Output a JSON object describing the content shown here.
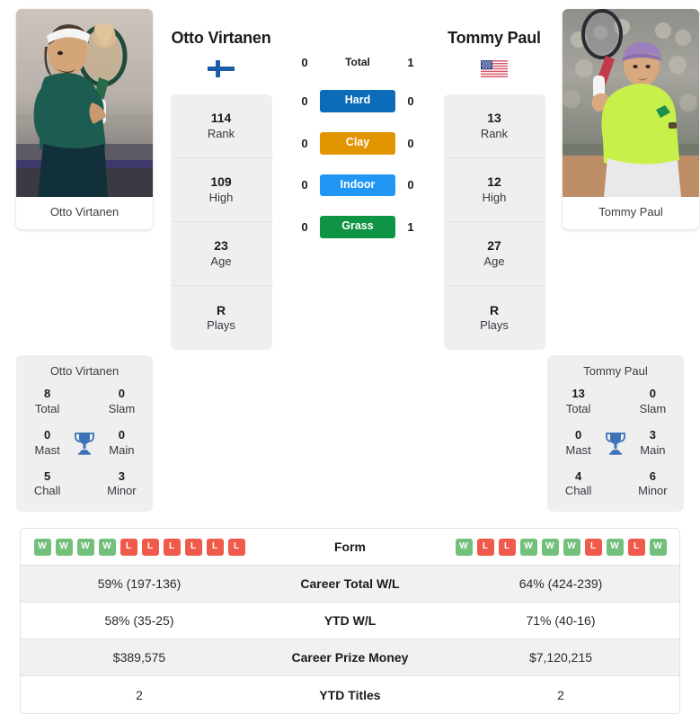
{
  "players": {
    "left": {
      "name": "Otto Virtanen",
      "photo_caption": "Otto Virtanen",
      "flag": "finland-flag",
      "stats": [
        {
          "value": "114",
          "label": "Rank"
        },
        {
          "value": "109",
          "label": "High"
        },
        {
          "value": "23",
          "label": "Age"
        },
        {
          "value": "R",
          "label": "Plays"
        }
      ],
      "titles": {
        "name": "Otto Virtanen",
        "total": "8",
        "total_label": "Total",
        "slam": "0",
        "slam_label": "Slam",
        "mast": "0",
        "mast_label": "Mast",
        "main": "0",
        "main_label": "Main",
        "chall": "5",
        "chall_label": "Chall",
        "minor": "3",
        "minor_label": "Minor"
      },
      "form": [
        "W",
        "W",
        "W",
        "W",
        "L",
        "L",
        "L",
        "L",
        "L",
        "L"
      ],
      "career_wl": "59% (197-136)",
      "ytd_wl": "58% (35-25)",
      "prize_money": "$389,575",
      "ytd_titles": "2"
    },
    "right": {
      "name": "Tommy Paul",
      "photo_caption": "Tommy Paul",
      "flag": "usa-flag",
      "stats": [
        {
          "value": "13",
          "label": "Rank"
        },
        {
          "value": "12",
          "label": "High"
        },
        {
          "value": "27",
          "label": "Age"
        },
        {
          "value": "R",
          "label": "Plays"
        }
      ],
      "titles": {
        "name": "Tommy Paul",
        "total": "13",
        "total_label": "Total",
        "slam": "0",
        "slam_label": "Slam",
        "mast": "0",
        "mast_label": "Mast",
        "main": "3",
        "main_label": "Main",
        "chall": "4",
        "chall_label": "Chall",
        "minor": "6",
        "minor_label": "Minor"
      },
      "form": [
        "W",
        "L",
        "L",
        "W",
        "W",
        "W",
        "L",
        "W",
        "L",
        "W"
      ],
      "career_wl": "64% (424-239)",
      "ytd_wl": "71% (40-16)",
      "prize_money": "$7,120,215",
      "ytd_titles": "2"
    }
  },
  "head_to_head": [
    {
      "label": "Total",
      "left": "0",
      "right": "1",
      "type": "total",
      "color": ""
    },
    {
      "label": "Hard",
      "left": "0",
      "right": "0",
      "type": "surface",
      "color": "#0d6cb9"
    },
    {
      "label": "Clay",
      "left": "0",
      "right": "0",
      "type": "surface",
      "color": "#e19500"
    },
    {
      "label": "Indoor",
      "left": "0",
      "right": "0",
      "type": "surface",
      "color": "#2196f3"
    },
    {
      "label": "Grass",
      "left": "0",
      "right": "1",
      "type": "surface",
      "color": "#0e9444"
    }
  ],
  "table_rows": [
    {
      "label": "Form",
      "left": "",
      "right": "",
      "kind": "form"
    },
    {
      "label": "Career Total W/L",
      "left": "59% (197-136)",
      "right": "64% (424-239)",
      "kind": "text"
    },
    {
      "label": "YTD W/L",
      "left": "58% (35-25)",
      "right": "71% (40-16)",
      "kind": "text"
    },
    {
      "label": "Career Prize Money",
      "left": "$389,575",
      "right": "$7,120,215",
      "kind": "text"
    },
    {
      "label": "YTD Titles",
      "left": "2",
      "right": "2",
      "kind": "text"
    }
  ],
  "icons": {
    "trophy": "trophy-icon"
  },
  "colors": {
    "hard": "#0d6cb9",
    "clay": "#e19500",
    "indoor": "#2196f3",
    "grass": "#0e9444",
    "win": "#72c07c",
    "loss": "#f05a4b"
  }
}
